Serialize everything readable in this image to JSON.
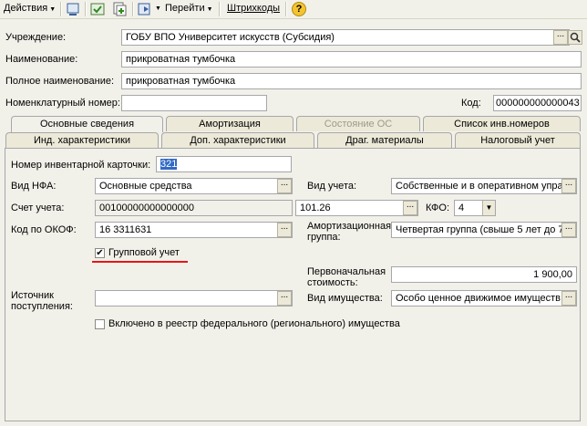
{
  "toolbar": {
    "actions_label": "Действия",
    "go_label": "Перейти",
    "barcodes_label": "Штрихкоды",
    "help_symbol": "?"
  },
  "header": {
    "institution_label": "Учреждение:",
    "institution_value": "ГОБУ ВПО Университет искусств (Субсидия)",
    "name_label": "Наименование:",
    "name_value": "прикроватная тумбочка",
    "full_name_label": "Полное наименование:",
    "full_name_value": "прикроватная тумбочка",
    "nomenclature_label": "Номенклатурный номер:",
    "nomenclature_value": "",
    "code_label": "Код:",
    "code_value": "000000000000043"
  },
  "tabs_row1": [
    "Основные сведения",
    "Амортизация",
    "Состояние ОС",
    "Список инв.номеров"
  ],
  "tabs_row2": [
    "Инд. характеристики",
    "Доп. характеристики",
    "Драг. материалы",
    "Налоговый учет"
  ],
  "main": {
    "inventory_card_label": "Номер инвентарной карточки:",
    "inventory_card_value": "321",
    "nfa_type_label": "Вид НФА:",
    "nfa_type_value": "Основные средства",
    "account_type_label": "Вид учета:",
    "account_type_value": "Собственные и в оперативном упра",
    "account_label": "Счет учета:",
    "account_value": "00100000000000000",
    "account_sub_value": "101.26",
    "kfo_label": "КФО:",
    "kfo_value": "4",
    "okof_label": "Код по ОКОФ:",
    "okof_value": "16 3311631",
    "amort_group_label_1": "Амортизационная",
    "amort_group_label_2": "группа:",
    "amort_group_value": "Четвертая группа (свыше 5 лет до 7",
    "group_account_label": "Групповой учет",
    "initial_cost_label_1": "Первоначальная",
    "initial_cost_label_2": "стоимость:",
    "initial_cost_value": "1 900,00",
    "source_label_1": "Источник",
    "source_label_2": "поступления:",
    "source_value": "",
    "property_type_label": "Вид имущества:",
    "property_type_value": "Особо ценное движимое имуществ",
    "registry_label": "Включено в реестр федерального (регионального) имущества"
  },
  "colors": {
    "accent_underline": "#e8141a",
    "selection": "#316ac5"
  }
}
